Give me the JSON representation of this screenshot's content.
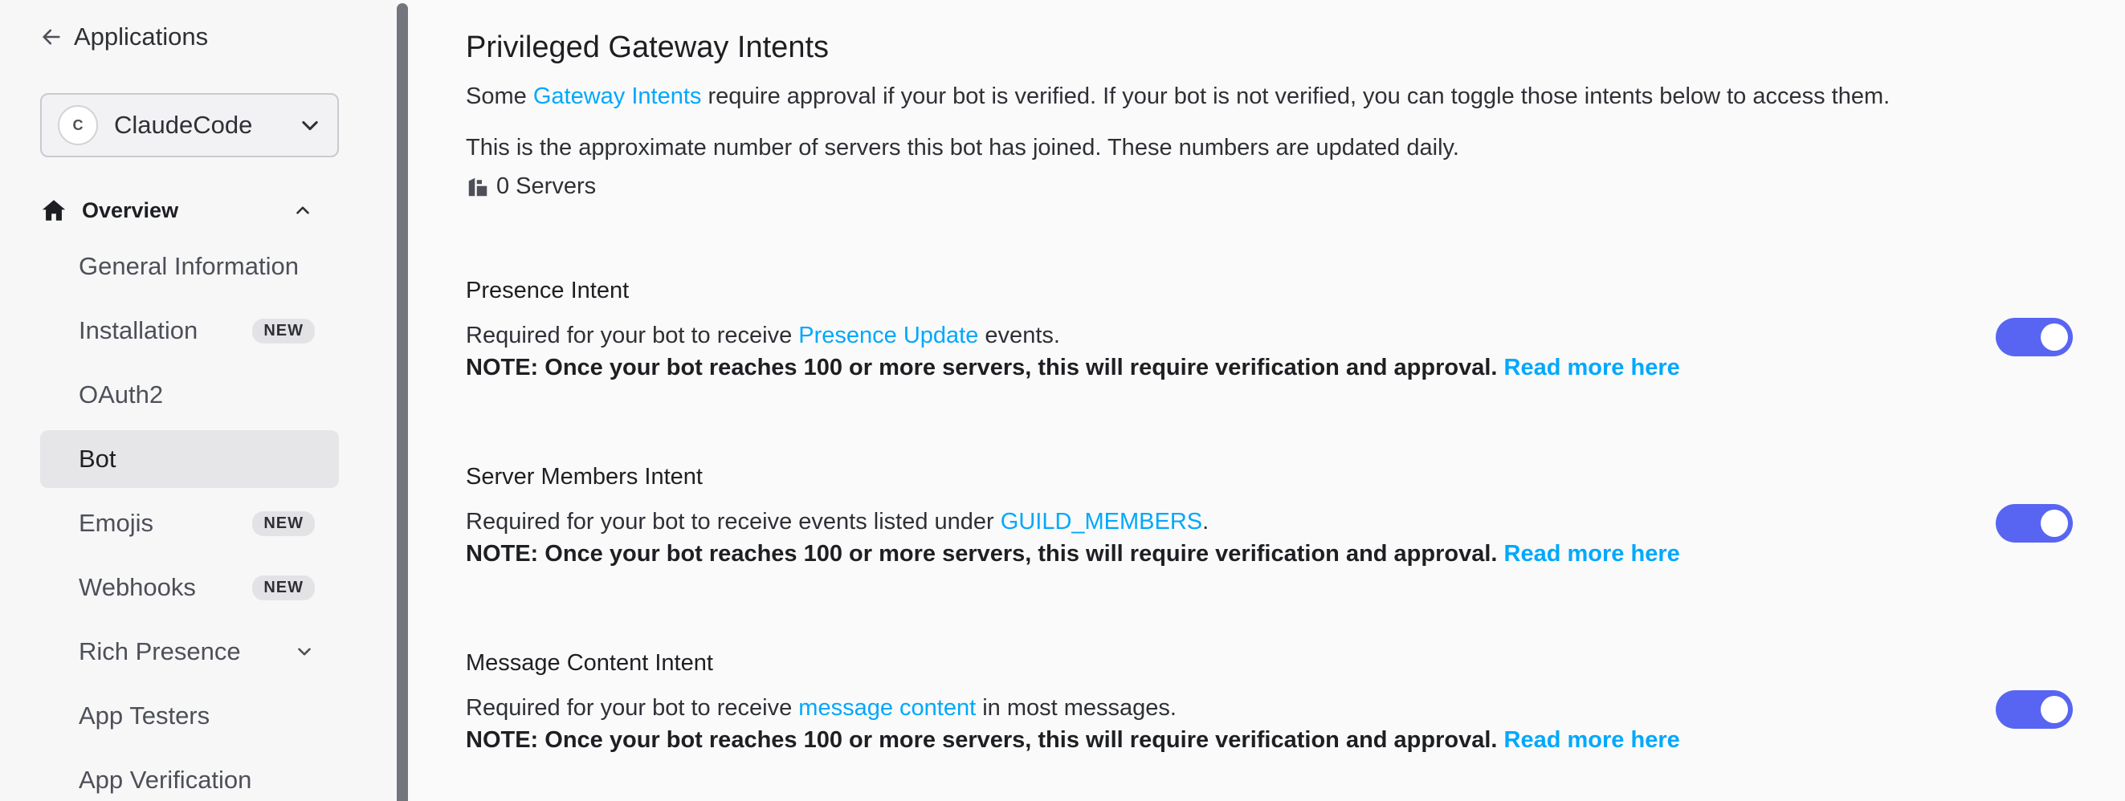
{
  "sidebar": {
    "back_label": "Applications",
    "app_selector": {
      "avatar_initial": "C",
      "name": "ClaudeCode"
    },
    "overview_label": "Overview",
    "items": [
      {
        "label": "General Information",
        "badge": ""
      },
      {
        "label": "Installation",
        "badge": "NEW"
      },
      {
        "label": "OAuth2",
        "badge": ""
      },
      {
        "label": "Bot",
        "badge": ""
      },
      {
        "label": "Emojis",
        "badge": "NEW"
      },
      {
        "label": "Webhooks",
        "badge": "NEW"
      },
      {
        "label": "Rich Presence",
        "badge": ""
      },
      {
        "label": "App Testers",
        "badge": ""
      },
      {
        "label": "App Verification",
        "badge": ""
      }
    ]
  },
  "main": {
    "heading": "Privileged Gateway Intents",
    "intro": {
      "pre": "Some ",
      "link": "Gateway Intents",
      "post": " require approval if your bot is verified. If your bot is not verified, you can toggle those intents below to access them."
    },
    "servers_note": "This is the approximate number of servers this bot has joined. These numbers are updated daily.",
    "servers_count": "0 Servers",
    "intents": [
      {
        "title": "Presence Intent",
        "desc_pre": "Required for your bot to receive ",
        "desc_link": "Presence Update",
        "desc_post": " events.",
        "note": "NOTE: Once your bot reaches 100 or more servers, this will require verification and approval.",
        "note_link": "Read more here",
        "enabled": true
      },
      {
        "title": "Server Members Intent",
        "desc_pre": "Required for your bot to receive events listed under ",
        "desc_link": "GUILD_MEMBERS",
        "desc_post": ".",
        "note": "NOTE: Once your bot reaches 100 or more servers, this will require verification and approval.",
        "note_link": "Read more here",
        "enabled": true
      },
      {
        "title": "Message Content Intent",
        "desc_pre": "Required for your bot to receive ",
        "desc_link": "message content",
        "desc_post": " in most messages.",
        "note": "NOTE: Once your bot reaches 100 or more servers, this will require verification and approval.",
        "note_link": "Read more here",
        "enabled": true
      }
    ]
  },
  "colors": {
    "accent": "#5865f2",
    "link": "#00a8fc",
    "text": "#1e1f22",
    "sidebar_active": "#e6e6e8"
  },
  "icons": {
    "back": "arrow-left-icon",
    "app_dropdown": "chevron-down-icon",
    "overview": "home-icon",
    "overview_toggle": "chevron-up-icon",
    "rich_presence_toggle": "chevron-down-icon",
    "servers": "servers-icon"
  }
}
